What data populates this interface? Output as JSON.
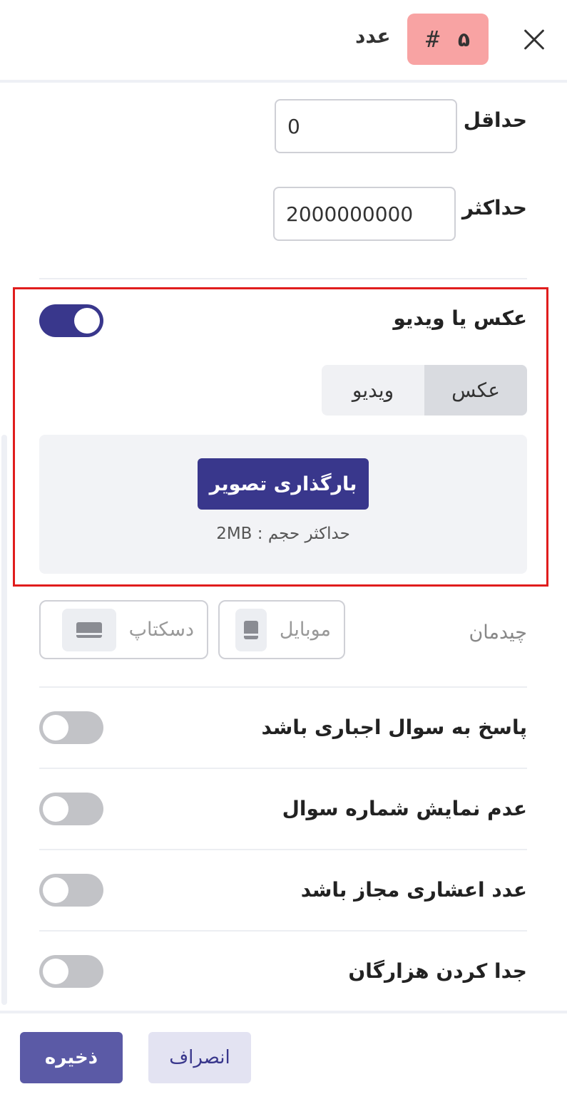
{
  "header": {
    "question_type": "عدد",
    "question_number": "۵",
    "hash_symbol": "#"
  },
  "number_range": {
    "min_label": "حداقل",
    "min_value": "0",
    "max_label": "حداکثر",
    "max_value": "2000000000"
  },
  "media": {
    "label": "عکس یا ویدیو",
    "enabled": true,
    "tabs": [
      {
        "label": "عکس",
        "active": true
      },
      {
        "label": "ویدیو",
        "active": false
      }
    ],
    "upload_button": "بارگذاری تصویر",
    "upload_hint": "حداکثر حجم : 2MB"
  },
  "layout": {
    "label": "چیدمان",
    "options": [
      {
        "label": "موبایل",
        "icon": "mobile-icon"
      },
      {
        "label": "دسکتاپ",
        "icon": "desktop-icon"
      }
    ]
  },
  "settings": [
    {
      "label": "پاسخ به سوال اجباری باشد",
      "enabled": false
    },
    {
      "label": "عدم نمایش شماره سوال",
      "enabled": false
    },
    {
      "label": "عدد اعشاری مجاز باشد",
      "enabled": false
    },
    {
      "label": "جدا کردن هزارگان",
      "enabled": false
    }
  ],
  "footer": {
    "save_label": "ذخیره",
    "cancel_label": "انصراف"
  },
  "colors": {
    "primary": "#39378c",
    "badge_bg": "#f8a3a3",
    "highlight_border": "#e01d1d"
  }
}
